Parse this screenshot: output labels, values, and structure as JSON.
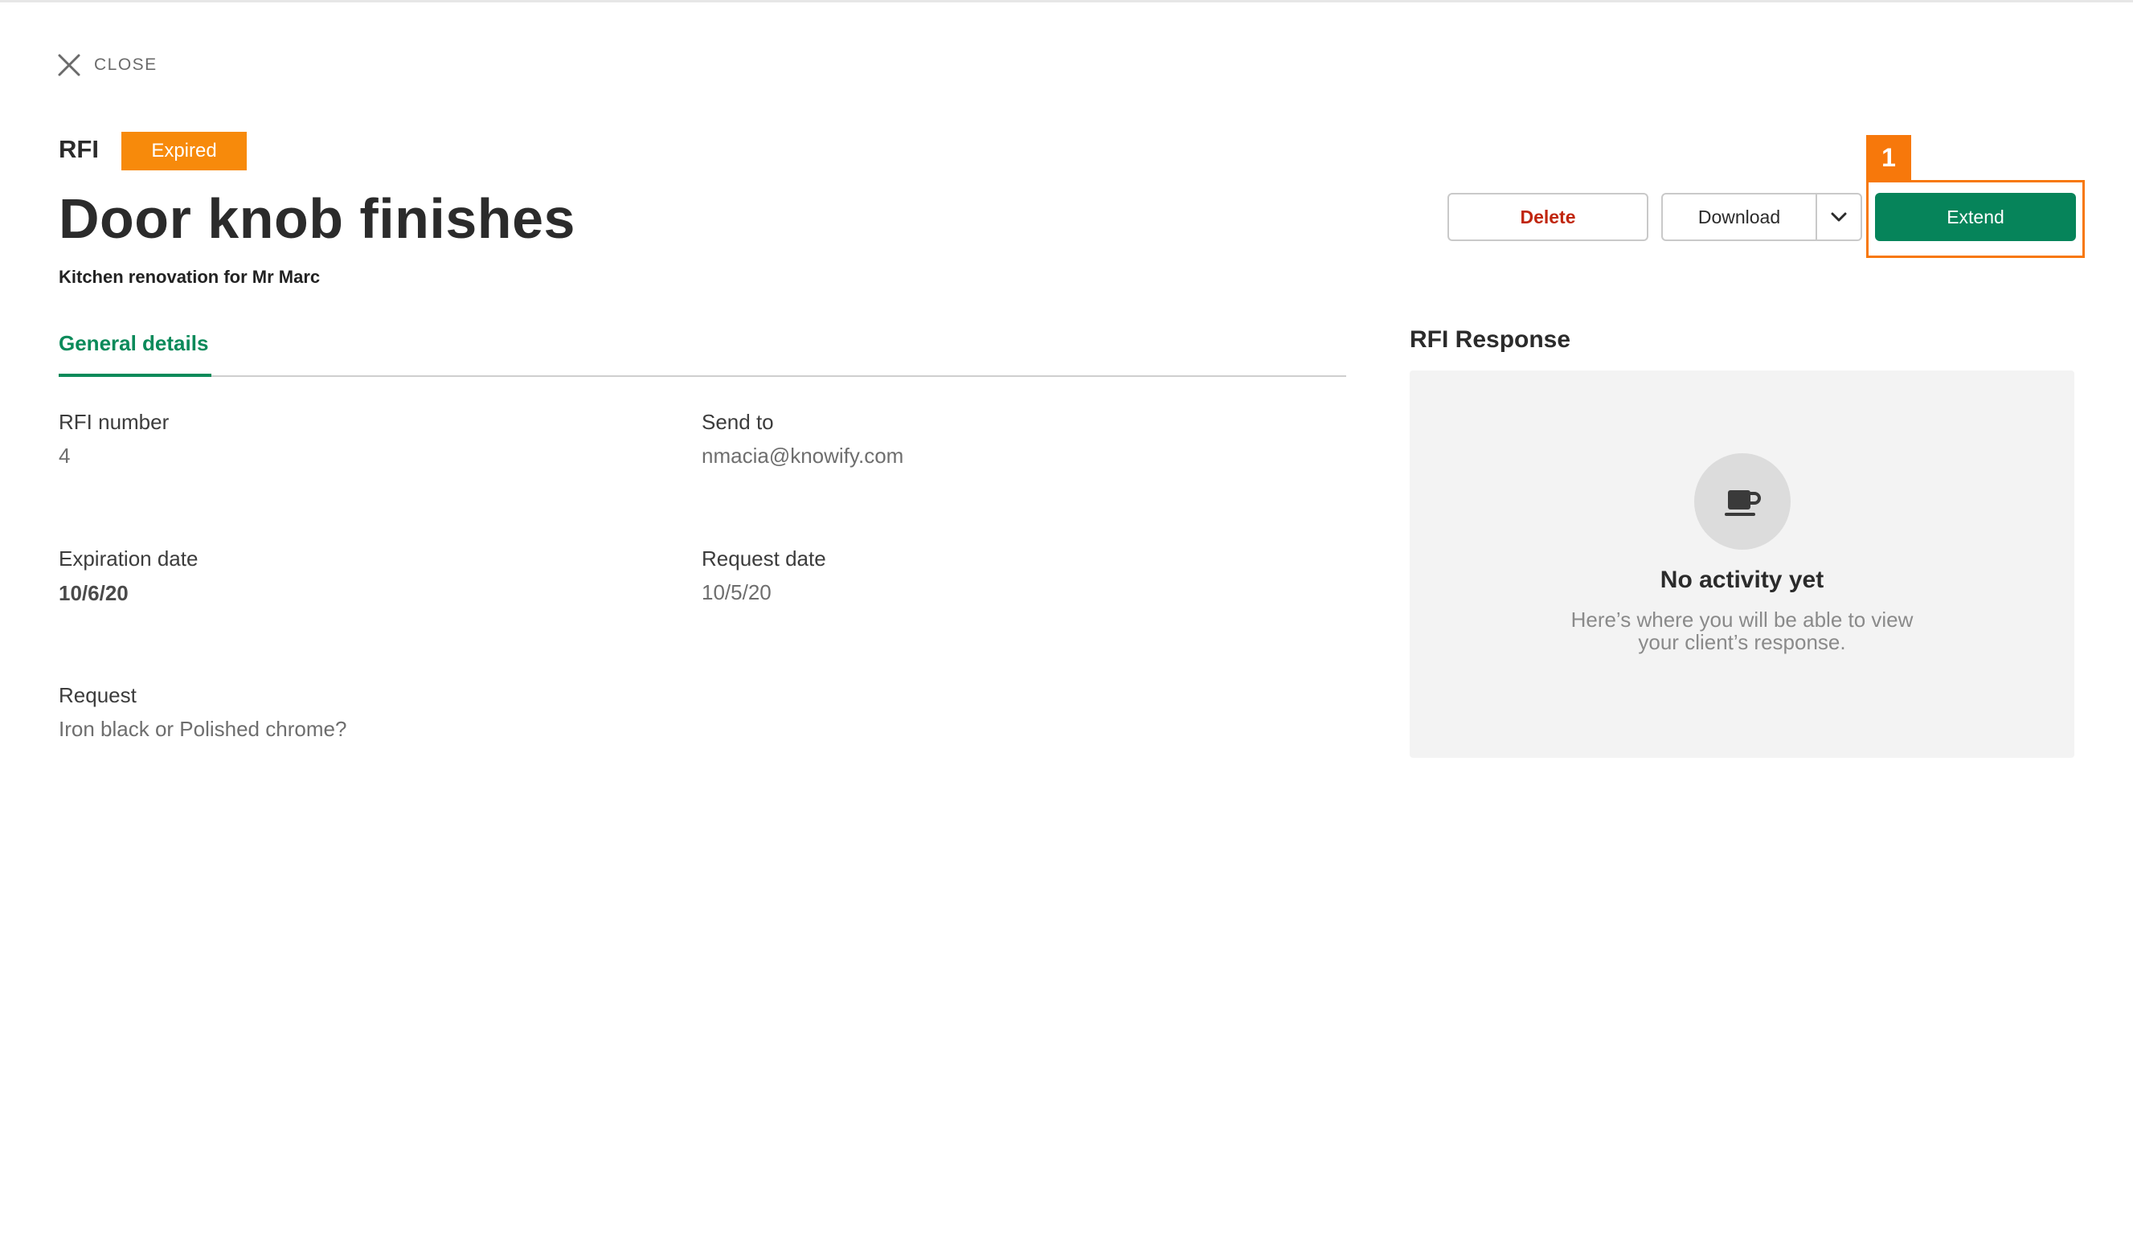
{
  "header": {
    "close_label": "CLOSE",
    "type_label": "RFI",
    "status": "Expired",
    "title": "Door knob finishes",
    "project": "Kitchen renovation for Mr Marc"
  },
  "actions": {
    "delete_label": "Delete",
    "download_label": "Download",
    "extend_label": "Extend"
  },
  "annotation": {
    "marker": "1"
  },
  "tabs": [
    {
      "label": "General details",
      "active": true
    }
  ],
  "details": {
    "rfi_number": {
      "label": "RFI number",
      "value": "4"
    },
    "send_to": {
      "label": "Send to",
      "value": "nmacia@knowify.com"
    },
    "expiration_date": {
      "label": "Expiration date",
      "value": "10/6/20"
    },
    "request_date": {
      "label": "Request date",
      "value": "10/5/20"
    },
    "request": {
      "label": "Request",
      "value": "Iron black or Polished chrome?"
    }
  },
  "response": {
    "title": "RFI Response",
    "empty_title": "No activity yet",
    "empty_text": "Here’s where you will be able to view your client’s response."
  },
  "colors": {
    "accent_green": "#06845a",
    "status_orange": "#f78a0b",
    "annotation_orange": "#f7780b",
    "danger_red": "#c0260e"
  },
  "icons": [
    "close-icon",
    "chevron-down-icon",
    "coffee-cup-icon"
  ]
}
